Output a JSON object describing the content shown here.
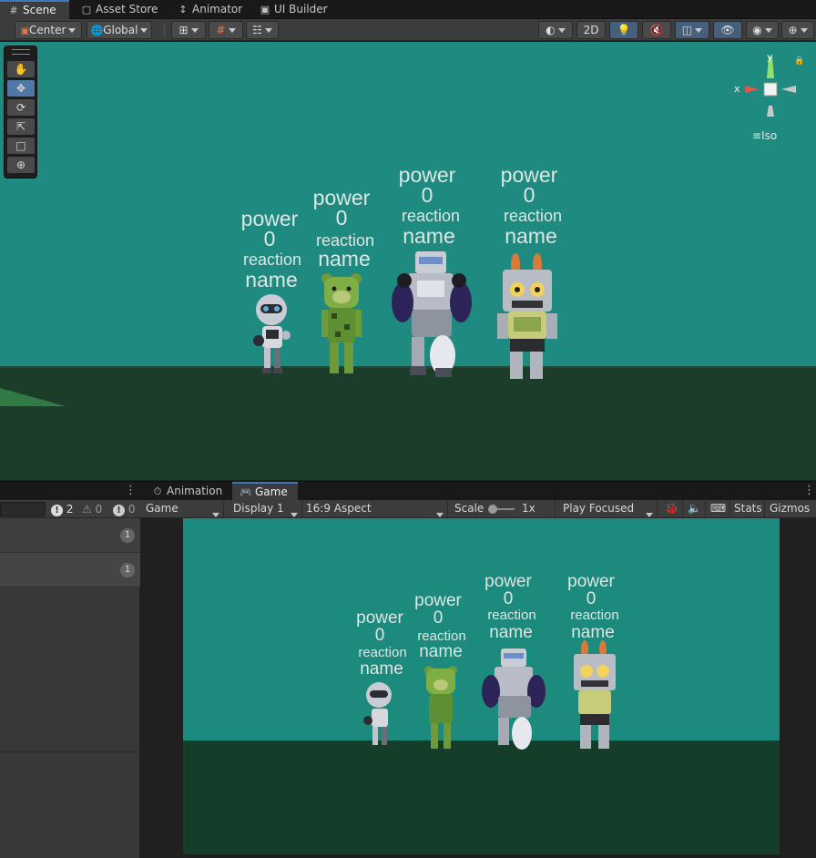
{
  "top_tabs": [
    {
      "label": "Scene",
      "icon": "grid-icon",
      "active": true
    },
    {
      "label": "Asset Store",
      "icon": "store-icon",
      "active": false
    },
    {
      "label": "Animator",
      "icon": "animator-icon",
      "active": false
    },
    {
      "label": "UI Builder",
      "icon": "ui-builder-icon",
      "active": false
    }
  ],
  "scene_toolbar": {
    "pivot_label": "Center",
    "space_label": "Global",
    "mode_2d_label": "2D"
  },
  "gizmo": {
    "y_label": "y",
    "x_label": "x",
    "projection_label": "Iso"
  },
  "characters": [
    {
      "power": "power",
      "value": "0",
      "reaction": "reaction",
      "name": "name",
      "kind": "white robot"
    },
    {
      "power": "power",
      "value": "0",
      "reaction": "reaction",
      "name": "name",
      "kind": "green bear"
    },
    {
      "power": "power",
      "value": "0",
      "reaction": "reaction",
      "name": "name",
      "kind": "silver mech"
    },
    {
      "power": "power",
      "value": "0",
      "reaction": "reaction",
      "name": "name",
      "kind": "bunny robot"
    }
  ],
  "bottom_tabs": [
    {
      "label": "Animation",
      "icon": "animation-icon",
      "active": false
    },
    {
      "label": "Game",
      "icon": "gamepad-icon",
      "active": true
    }
  ],
  "console_counts": {
    "info": "2",
    "warn": "0",
    "error": "0"
  },
  "game_toolbar": {
    "target": "Game",
    "display": "Display 1",
    "aspect": "16:9 Aspect",
    "scale_label": "Scale",
    "scale_value": "1x",
    "play_mode": "Play Focused",
    "stats": "Stats",
    "gizmos": "Gizmos"
  },
  "left_panel_rows": [
    {
      "badge": "1"
    },
    {
      "badge": "1"
    }
  ],
  "colors": {
    "sky": "#1f8a7f",
    "ground": "#1b3d29",
    "accent": "#3a79bb"
  }
}
